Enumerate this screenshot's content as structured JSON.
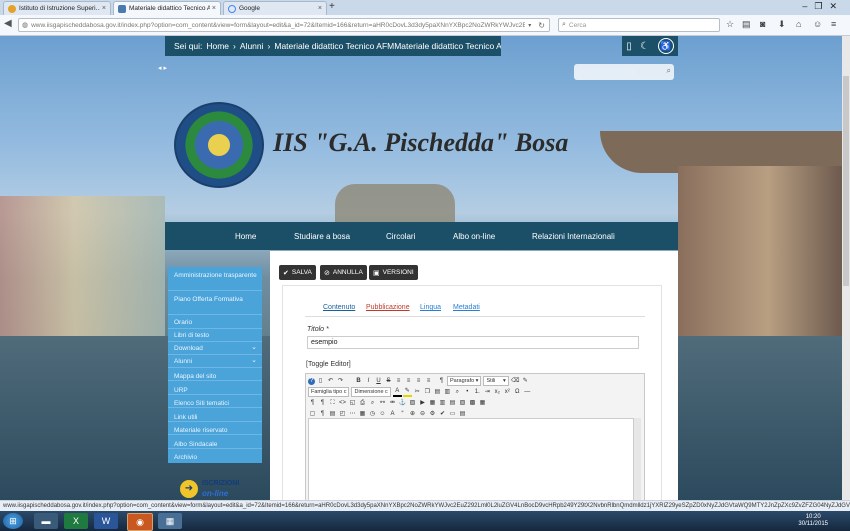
{
  "browser": {
    "tabs": [
      {
        "label": "Istituto di Istruzione Superi...",
        "active": false
      },
      {
        "label": "Materiale didattico Tecnico AF...",
        "active": true
      },
      {
        "label": "Google",
        "active": false
      }
    ],
    "url": "www.iisgapischeddabosa.gov.it/index.php?option=com_content&view=form&layout=edit&a_id=72&Itemid=166&return=aHR0cDovL3d3dy5paXNnYXBpc2NoZWRkYWJvc2EuZ292Lml",
    "search_placeholder": "Cerca",
    "status_url": "www.iisgapischeddabosa.gov.it/index.php?option=com_content&view=form&layout=edit&a_id=72&Itemid=166&return=aHR0cDovL3d3dy5paXNnYXBpc2NoZWRkYWJvc2EuZ292Lml0L2luZGV4LnBocD9vcHRpb249Y29tX2NvbnRlbnQmdmlldz1jYXRlZ29yeSZpZD0xNyZJdGVtaWQ9MTY2JnZpZXc9ZvZFZG04NyZJdGVtaWQ9MTY2#publishing"
  },
  "breadcrumb": {
    "prefix": "Sei qui:",
    "items": [
      "Home",
      "Alunni",
      "Materiale didattico Tecnico AFMMateriale didattico Tecnico AFM"
    ]
  },
  "site": {
    "title": "IIS \"G.A. Pischedda\" Bosa"
  },
  "main_nav": [
    "Home",
    "Studiare a bosa",
    "Circolari",
    "Albo on-line",
    "Relazioni Internazionali"
  ],
  "sidebar": [
    {
      "label": "Amministrazione trasparente",
      "has_children": false
    },
    {
      "label": "Piano Offerta Formativa",
      "has_children": false
    },
    {
      "label": "Orario",
      "has_children": false
    },
    {
      "label": "Libri di testo",
      "has_children": false
    },
    {
      "label": "Download",
      "has_children": true
    },
    {
      "label": "Alunni",
      "has_children": true
    },
    {
      "label": "Mappa del sito",
      "has_children": false
    },
    {
      "label": "URP",
      "has_children": false
    },
    {
      "label": "Elenco Siti tematici",
      "has_children": false
    },
    {
      "label": "Link utili",
      "has_children": false
    },
    {
      "label": "Materiale riservato",
      "has_children": false
    },
    {
      "label": "Albo Sindacale",
      "has_children": false
    },
    {
      "label": "Archivio",
      "has_children": false
    }
  ],
  "iscrizioni": {
    "line1": "ISCRIZIONI",
    "line2": "on-line"
  },
  "toolbar": {
    "save": "SALVA",
    "cancel": "ANNULLA",
    "versions": "VERSIONI"
  },
  "form_tabs": [
    {
      "label": "Contenuto",
      "active": true
    },
    {
      "label": "Pubblicazione",
      "active": false
    },
    {
      "label": "Lingua",
      "active": false
    },
    {
      "label": "Metadati",
      "active": false
    }
  ],
  "title_field": {
    "label": "Titolo *",
    "value": "esempio"
  },
  "toggle_editor": "[Toggle Editor]",
  "editor": {
    "format_select": "Paragrafo",
    "style_select": "Stili",
    "font_select": "Famiglia tipo c",
    "size_select": "Dimensione c"
  },
  "clock": {
    "time": "10:20",
    "date": "30/11/2015"
  },
  "colors": {
    "nav_bar": "#1b4f67",
    "sidebar": "#4aa3d9",
    "button_dark": "#333333"
  }
}
